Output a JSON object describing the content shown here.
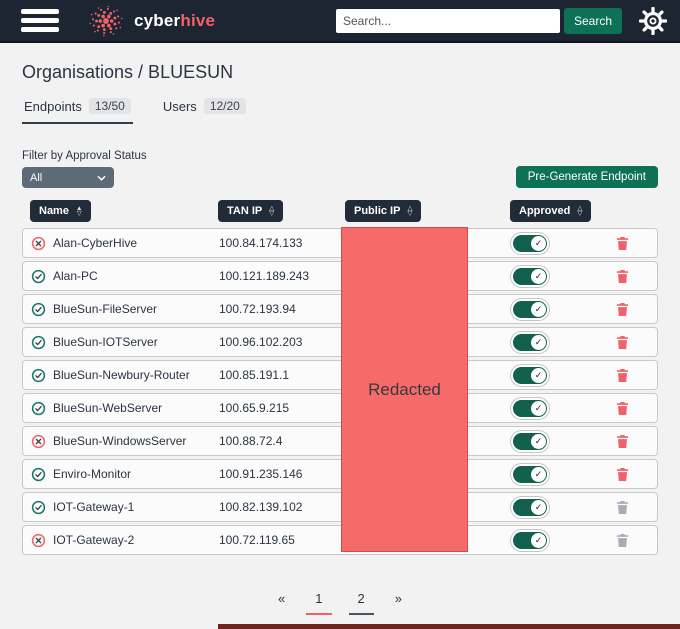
{
  "header": {
    "brand_cyber": "cyber",
    "brand_hive": "hive",
    "search_placeholder": "Search...",
    "search_button": "Search"
  },
  "page": {
    "title": "Organisations / BLUESUN"
  },
  "tabs": [
    {
      "label": "Endpoints",
      "badge": "13/50",
      "active": true
    },
    {
      "label": "Users",
      "badge": "12/20",
      "active": false
    }
  ],
  "filter": {
    "label": "Filter by Approval Status",
    "value": "All"
  },
  "actions": {
    "pre_generate": "Pre-Generate Endpoint"
  },
  "table": {
    "columns": [
      {
        "label": "Name",
        "sort": "asc"
      },
      {
        "label": "TAN IP",
        "sort": "none"
      },
      {
        "label": "Public IP",
        "sort": "none"
      },
      {
        "label": "Approved",
        "sort": "none"
      }
    ],
    "redacted_label": "Redacted",
    "rows": [
      {
        "name": "Alan-CyberHive",
        "tan_ip": "100.84.174.133",
        "status": "denied",
        "approved": true,
        "delete_enabled": true
      },
      {
        "name": "Alan-PC",
        "tan_ip": "100.121.189.243",
        "status": "approved",
        "approved": true,
        "delete_enabled": true
      },
      {
        "name": "BlueSun-FileServer",
        "tan_ip": "100.72.193.94",
        "status": "approved",
        "approved": true,
        "delete_enabled": true
      },
      {
        "name": "BlueSun-IOTServer",
        "tan_ip": "100.96.102.203",
        "status": "approved",
        "approved": true,
        "delete_enabled": true
      },
      {
        "name": "BlueSun-Newbury-Router",
        "tan_ip": "100.85.191.1",
        "status": "approved",
        "approved": true,
        "delete_enabled": true
      },
      {
        "name": "BlueSun-WebServer",
        "tan_ip": "100.65.9.215",
        "status": "approved",
        "approved": true,
        "delete_enabled": true
      },
      {
        "name": "BlueSun-WindowsServer",
        "tan_ip": "100.88.72.4",
        "status": "denied",
        "approved": true,
        "delete_enabled": true
      },
      {
        "name": "Enviro-Monitor",
        "tan_ip": "100.91.235.146",
        "status": "approved",
        "approved": true,
        "delete_enabled": true
      },
      {
        "name": "IOT-Gateway-1",
        "tan_ip": "100.82.139.102",
        "status": "approved",
        "approved": true,
        "delete_enabled": false
      },
      {
        "name": "IOT-Gateway-2",
        "tan_ip": "100.72.119.65",
        "status": "denied",
        "approved": true,
        "delete_enabled": false
      }
    ]
  },
  "pagination": {
    "prev": "«",
    "pages": [
      {
        "label": "1",
        "active": true
      },
      {
        "label": "2",
        "active": false
      }
    ],
    "next": "»"
  },
  "colors": {
    "header_bg": "#1c2531",
    "accent_teal": "#0d7156",
    "accent_coral": "#f0626a",
    "toggle_teal": "#11614e",
    "redacted_fill": "#f76a6a",
    "footer_maroon": "#6e2320"
  }
}
